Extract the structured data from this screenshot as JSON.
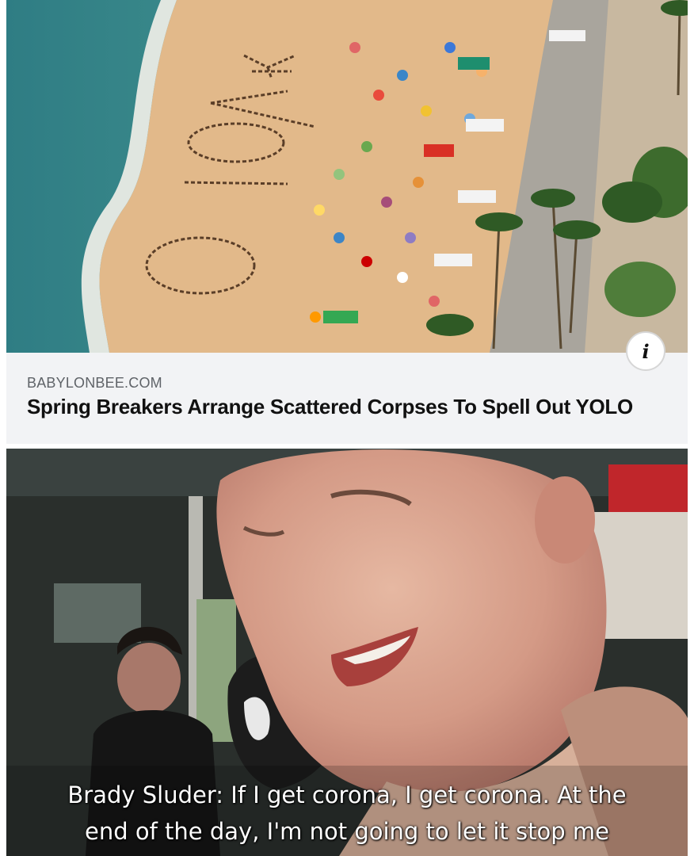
{
  "article": {
    "source": "BABYLONBEE.COM",
    "headline": "Spring Breakers Arrange Scattered Corpses To Spell Out YOLO",
    "info_icon": "info-icon",
    "info_glyph": "i"
  },
  "beach_image": {
    "letters": [
      "Y",
      "O",
      "L",
      "O"
    ]
  },
  "video": {
    "caption_line1": "Brady Sluder: If I get corona, I get corona. At the",
    "caption_line2": "end of the day, I'm not going to let it stop me"
  },
  "colors": {
    "ocean": "#3d8c8a",
    "sand": "#e2b98a",
    "card_background": "#f2f3f5"
  }
}
